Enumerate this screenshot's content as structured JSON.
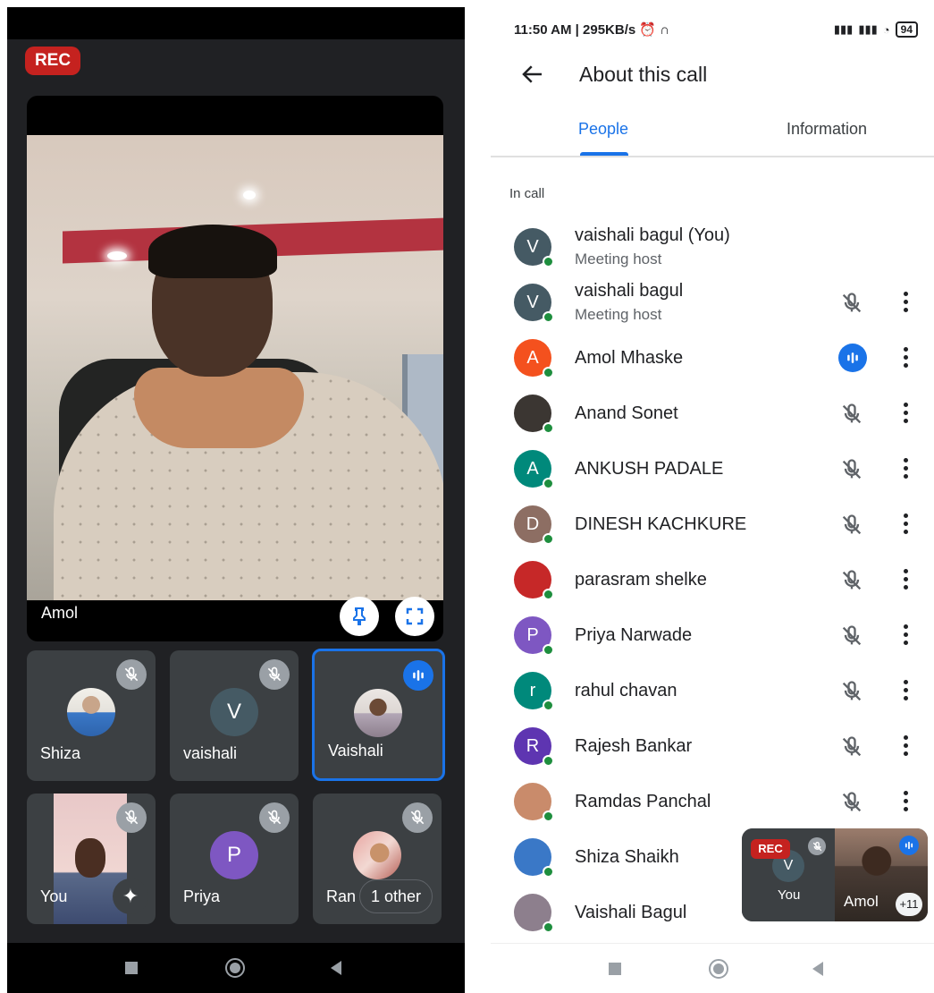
{
  "left": {
    "rec_label": "REC",
    "main_tile": {
      "name": "Amol"
    },
    "tiles_row1": [
      {
        "name": "Shiza",
        "muted": true,
        "avatar": "photo"
      },
      {
        "name": "vaishali",
        "muted": true,
        "avatar_letter": "V",
        "avatar_color": "#455a64"
      },
      {
        "name": "Vaishali",
        "speaking": true,
        "avatar": "photo"
      }
    ],
    "tiles_row2": [
      {
        "name": "You",
        "muted": true,
        "video": true
      },
      {
        "name": "Priya",
        "muted": true,
        "avatar_letter": "P",
        "avatar_color": "#7e57c2"
      },
      {
        "name": "Ran",
        "muted": true,
        "avatar": "photo",
        "chip": "1 other"
      }
    ]
  },
  "right": {
    "status_time": "11:50 AM | 295KB/s",
    "battery": "94",
    "title": "About this call",
    "tabs": [
      "People",
      "Information"
    ],
    "active_tab": "People",
    "section_label": "In call",
    "people": [
      {
        "name": "vaishali bagul (You)",
        "sub": "Meeting host",
        "letter": "V",
        "color": "#455a64",
        "state": "none"
      },
      {
        "name": "vaishali bagul",
        "sub": "Meeting host",
        "letter": "V",
        "color": "#455a64",
        "state": "muted"
      },
      {
        "name": "Amol Mhaske",
        "letter": "A",
        "color": "#f4511e",
        "state": "speaking"
      },
      {
        "name": "Anand Sonet",
        "letter": "",
        "color": "#3b3632",
        "state": "muted"
      },
      {
        "name": "ANKUSH PADALE",
        "letter": "A",
        "color": "#00897b",
        "state": "muted"
      },
      {
        "name": "DINESH KACHKURE",
        "letter": "D",
        "color": "#8d6e63",
        "state": "muted"
      },
      {
        "name": "parasram shelke",
        "letter": "",
        "color": "#c62828",
        "state": "muted"
      },
      {
        "name": "Priya Narwade",
        "letter": "P",
        "color": "#7e57c2",
        "state": "muted"
      },
      {
        "name": "rahul chavan",
        "letter": "r",
        "color": "#00897b",
        "state": "muted"
      },
      {
        "name": "Rajesh Bankar",
        "letter": "R",
        "color": "#5e35b1",
        "state": "muted"
      },
      {
        "name": "Ramdas Panchal",
        "letter": "",
        "color": "#c98b6b",
        "state": "muted"
      },
      {
        "name": "Shiza Shaikh",
        "letter": "",
        "color": "#3a78c7",
        "state": "none"
      },
      {
        "name": "Vaishali Bagul",
        "letter": "",
        "color": "#8d7f8d",
        "state": "none"
      }
    ],
    "pip": {
      "rec_label": "REC",
      "you_letter": "V",
      "you_label": "You",
      "amol_label": "Amol",
      "plus_count": "+11"
    }
  }
}
